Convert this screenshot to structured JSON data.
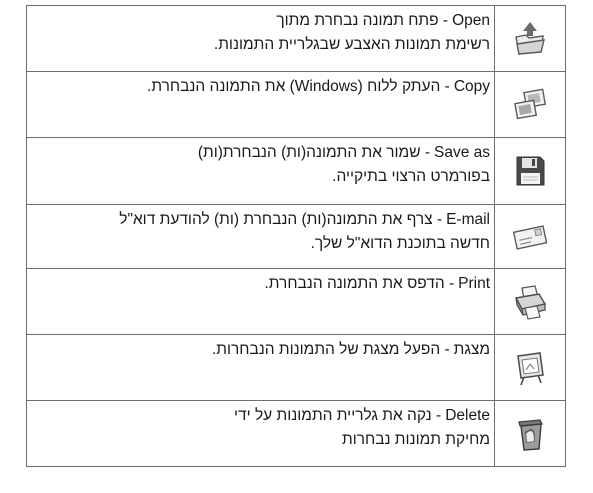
{
  "rows": [
    {
      "keyword": "Open",
      "line1": "- פתח תמונה נבחרת מתוך",
      "line2": "רשימת תמונות האצבע שבגלריית התמונות.",
      "icon": "open-folder-icon"
    },
    {
      "keyword": "Copy",
      "line1": "- העתק ללוח (Windows) את התמונה הנבחרת.",
      "line2": "",
      "icon": "copy-images-icon"
    },
    {
      "keyword": "Save as",
      "line1": "- שמור את התמונה(ות) הנבחרת(ות)",
      "line2": "בפורמרט הרצוי בתיקייה.",
      "icon": "floppy-disk-icon"
    },
    {
      "keyword": "E-mail",
      "line1": "- צרף את התמונה(ות) הנבחרת (ות) להודעת דוא\"ל",
      "line2": "חדשה בתוכנת הדוא\"ל שלך.",
      "icon": "envelope-icon"
    },
    {
      "keyword": "Print",
      "line1": "- הדפס את התמונה הנבחרת.",
      "line2": "",
      "icon": "printer-icon"
    },
    {
      "keyword": "מצגת",
      "line1": "- הפעל מצגת של התמונות הנבחרות.",
      "line2": "",
      "icon": "slideshow-icon"
    },
    {
      "keyword": "Delete",
      "line1": "- נקה את גלריית התמונות על ידי",
      "line2": "מחיקת תמונות נבחרות",
      "icon": "trash-bin-icon"
    }
  ]
}
